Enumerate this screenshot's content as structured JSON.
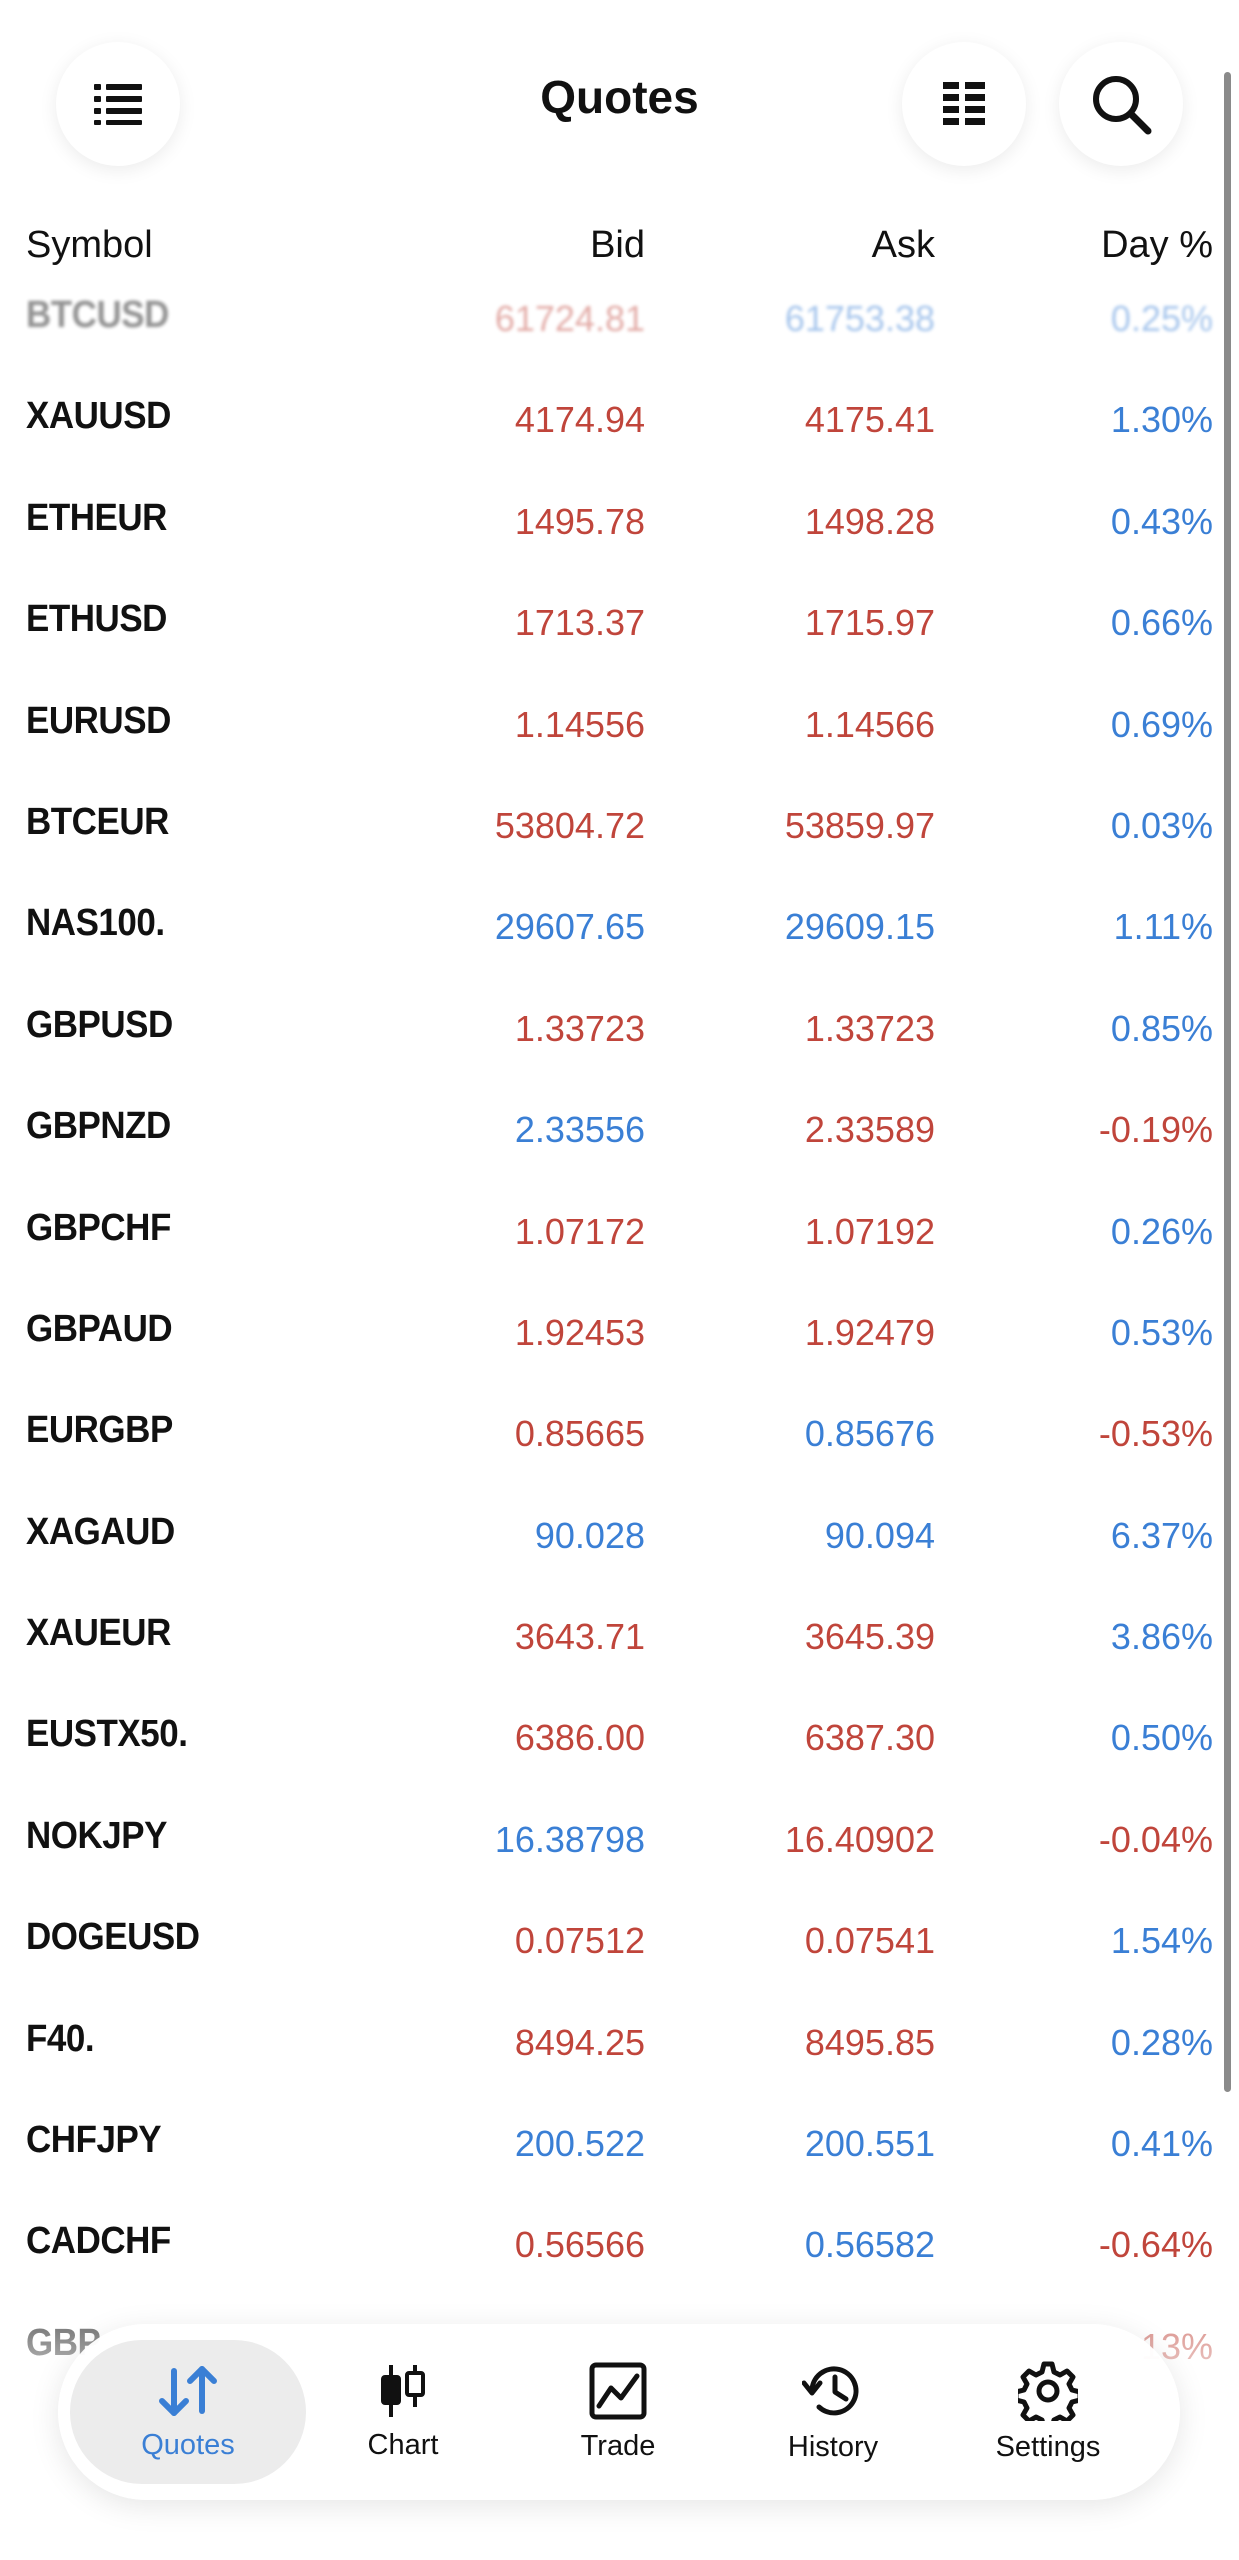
{
  "header": {
    "title": "Quotes"
  },
  "columns": {
    "symbol": "Symbol",
    "bid": "Bid",
    "ask": "Ask",
    "day": "Day %"
  },
  "quotes": [
    {
      "symbol": "BTCUSD",
      "bid": "61724.81",
      "ask": "61753.38",
      "day": "0.25%",
      "bid_color": "red",
      "ask_color": "blue",
      "day_color": "blue"
    },
    {
      "symbol": "XAUUSD",
      "bid": "4174.94",
      "ask": "4175.41",
      "day": "1.30%",
      "bid_color": "red",
      "ask_color": "red",
      "day_color": "blue"
    },
    {
      "symbol": "ETHEUR",
      "bid": "1495.78",
      "ask": "1498.28",
      "day": "0.43%",
      "bid_color": "red",
      "ask_color": "red",
      "day_color": "blue"
    },
    {
      "symbol": "ETHUSD",
      "bid": "1713.37",
      "ask": "1715.97",
      "day": "0.66%",
      "bid_color": "red",
      "ask_color": "red",
      "day_color": "blue"
    },
    {
      "symbol": "EURUSD",
      "bid": "1.14556",
      "ask": "1.14566",
      "day": "0.69%",
      "bid_color": "red",
      "ask_color": "red",
      "day_color": "blue"
    },
    {
      "symbol": "BTCEUR",
      "bid": "53804.72",
      "ask": "53859.97",
      "day": "0.03%",
      "bid_color": "red",
      "ask_color": "red",
      "day_color": "blue"
    },
    {
      "symbol": "NAS100.",
      "bid": "29607.65",
      "ask": "29609.15",
      "day": "1.11%",
      "bid_color": "blue",
      "ask_color": "blue",
      "day_color": "blue"
    },
    {
      "symbol": "GBPUSD",
      "bid": "1.33723",
      "ask": "1.33723",
      "day": "0.85%",
      "bid_color": "red",
      "ask_color": "red",
      "day_color": "blue"
    },
    {
      "symbol": "GBPNZD",
      "bid": "2.33556",
      "ask": "2.33589",
      "day": "-0.19%",
      "bid_color": "blue",
      "ask_color": "red",
      "day_color": "red"
    },
    {
      "symbol": "GBPCHF",
      "bid": "1.07172",
      "ask": "1.07192",
      "day": "0.26%",
      "bid_color": "red",
      "ask_color": "red",
      "day_color": "blue"
    },
    {
      "symbol": "GBPAUD",
      "bid": "1.92453",
      "ask": "1.92479",
      "day": "0.53%",
      "bid_color": "red",
      "ask_color": "red",
      "day_color": "blue"
    },
    {
      "symbol": "EURGBP",
      "bid": "0.85665",
      "ask": "0.85676",
      "day": "-0.53%",
      "bid_color": "red",
      "ask_color": "blue",
      "day_color": "red"
    },
    {
      "symbol": "XAGAUD",
      "bid": "90.028",
      "ask": "90.094",
      "day": "6.37%",
      "bid_color": "blue",
      "ask_color": "blue",
      "day_color": "blue"
    },
    {
      "symbol": "XAUEUR",
      "bid": "3643.71",
      "ask": "3645.39",
      "day": "3.86%",
      "bid_color": "red",
      "ask_color": "red",
      "day_color": "blue"
    },
    {
      "symbol": "EUSTX50.",
      "bid": "6386.00",
      "ask": "6387.30",
      "day": "0.50%",
      "bid_color": "red",
      "ask_color": "red",
      "day_color": "blue"
    },
    {
      "symbol": "NOKJPY",
      "bid": "16.38798",
      "ask": "16.40902",
      "day": "-0.04%",
      "bid_color": "blue",
      "ask_color": "red",
      "day_color": "red"
    },
    {
      "symbol": "DOGEUSD",
      "bid": "0.07512",
      "ask": "0.07541",
      "day": "1.54%",
      "bid_color": "red",
      "ask_color": "red",
      "day_color": "blue"
    },
    {
      "symbol": "F40.",
      "bid": "8494.25",
      "ask": "8495.85",
      "day": "0.28%",
      "bid_color": "red",
      "ask_color": "red",
      "day_color": "blue"
    },
    {
      "symbol": "CHFJPY",
      "bid": "200.522",
      "ask": "200.551",
      "day": "0.41%",
      "bid_color": "blue",
      "ask_color": "blue",
      "day_color": "blue"
    },
    {
      "symbol": "CADCHF",
      "bid": "0.56566",
      "ask": "0.56582",
      "day": "-0.64%",
      "bid_color": "red",
      "ask_color": "blue",
      "day_color": "red"
    },
    {
      "symbol": "GBP",
      "bid": "",
      "ask": "",
      "day": "13%",
      "bid_color": "red",
      "ask_color": "red",
      "day_color": "red"
    }
  ],
  "nav": {
    "items": [
      {
        "label": "Quotes",
        "icon": "quotes-arrows-icon"
      },
      {
        "label": "Chart",
        "icon": "candlestick-icon"
      },
      {
        "label": "Trade",
        "icon": "trade-chart-icon"
      },
      {
        "label": "History",
        "icon": "history-clock-icon"
      },
      {
        "label": "Settings",
        "icon": "gear-icon"
      }
    ],
    "active": "Quotes"
  },
  "colors": {
    "red": "#c0453b",
    "blue": "#3a7fd5",
    "active": "#3a7fd5"
  }
}
